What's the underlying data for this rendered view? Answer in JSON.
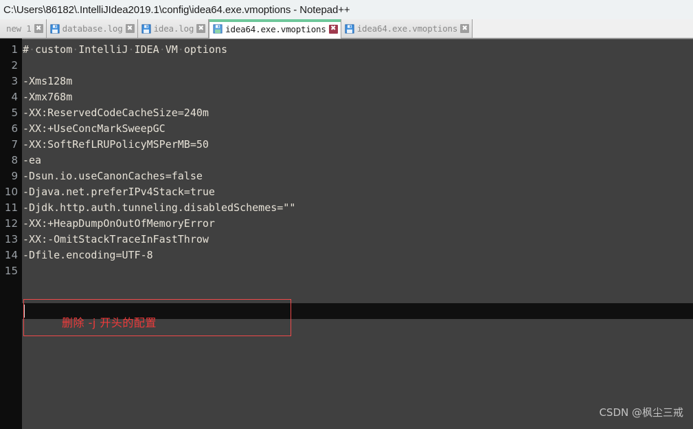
{
  "window": {
    "title": "C:\\Users\\86182\\.IntelliJIdea2019.1\\config\\idea64.exe.vmoptions - Notepad++",
    "app_name": "Notepad++"
  },
  "tabs": [
    {
      "label": "new 1",
      "icon": "floppy-disk-icon",
      "close_icon": "close-icon",
      "active": false,
      "has_icon": false
    },
    {
      "label": "database.log",
      "icon": "floppy-disk-icon",
      "close_icon": "close-icon",
      "active": false,
      "has_icon": true
    },
    {
      "label": "idea.log",
      "icon": "floppy-disk-icon",
      "close_icon": "close-icon",
      "active": false,
      "has_icon": true
    },
    {
      "label": "idea64.exe.vmoptions",
      "icon": "floppy-disk-icon",
      "close_icon": "close-icon",
      "active": true,
      "has_icon": true
    },
    {
      "label": "idea64.exe.vmoptions",
      "icon": "floppy-disk-icon",
      "close_icon": "close-icon",
      "active": false,
      "has_icon": true
    }
  ],
  "tab_close_glyph": "✖",
  "editor": {
    "line_numbers": [
      "1",
      "2",
      "3",
      "4",
      "5",
      "6",
      "7",
      "8",
      "9",
      "10",
      "11",
      "12",
      "13",
      "14",
      "15"
    ],
    "lines": [
      "# custom IntelliJ IDEA VM options",
      "",
      "-Xms128m",
      "-Xmx768m",
      "-XX:ReservedCodeCacheSize=240m",
      "-XX:+UseConcMarkSweepGC",
      "-XX:SoftRefLRUPolicyMSPerMB=50",
      "-ea",
      "-Dsun.io.useCanonCaches=false",
      "-Djava.net.preferIPv4Stack=true",
      "-Djdk.http.auth.tunneling.disabledSchemes=\"\"",
      "-XX:+HeapDumpOnOutOfMemoryError",
      "-XX:-OmitStackTraceInFastThrow",
      "-Dfile.encoding=UTF-8",
      ""
    ],
    "caret_line": 15,
    "colors": {
      "background": "#404040",
      "gutter_background": "#0d0d0d",
      "text": "#e6e1d6",
      "line_number": "#9aa0a6",
      "current_line": "#101010"
    }
  },
  "annotation": {
    "text": "删除 -j 开头的配置",
    "color": "#ef3b3b"
  },
  "watermark": {
    "text": "CSDN @枫尘三戒"
  }
}
